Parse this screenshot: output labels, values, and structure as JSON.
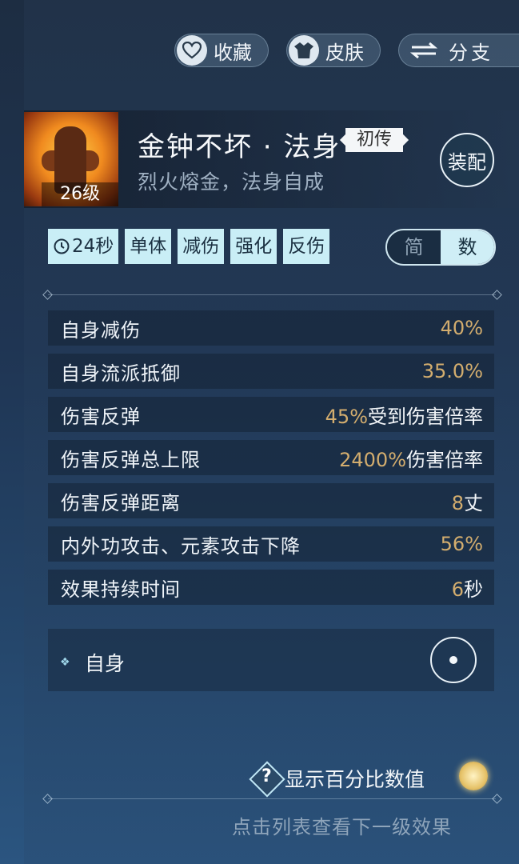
{
  "top_buttons": {
    "favorite": "收藏",
    "skin": "皮肤",
    "branch": "分支"
  },
  "skill": {
    "level": "26级",
    "name": "金钟不坏 · 法身",
    "stage": "初传",
    "subtitle": "烈火熔金，法身自成",
    "equip": "装配"
  },
  "tags": {
    "cooldown": "24秒",
    "items": [
      "单体",
      "减伤",
      "强化",
      "反伤"
    ]
  },
  "mode_toggle": {
    "simple": "简",
    "numeric": "数",
    "selected": "数"
  },
  "stats": [
    {
      "label": "自身减伤",
      "value": "40%",
      "unit": ""
    },
    {
      "label": "自身流派抵御",
      "value": "35.0%",
      "unit": ""
    },
    {
      "label": "伤害反弹",
      "value": "45%",
      "unit": "受到伤害倍率"
    },
    {
      "label": "伤害反弹总上限",
      "value": "2400%",
      "unit": "伤害倍率"
    },
    {
      "label": "伤害反弹距离",
      "value": "8",
      "unit": "丈"
    },
    {
      "label": "内外功攻击、元素攻击下降",
      "value": "56%",
      "unit": ""
    },
    {
      "label": "效果持续时间",
      "value": "6",
      "unit": "秒"
    }
  ],
  "target": {
    "label": "自身"
  },
  "percent_toggle": {
    "label": "显示百分比数值",
    "help": "?"
  },
  "footer_hint": "点击列表查看下一级效果"
}
